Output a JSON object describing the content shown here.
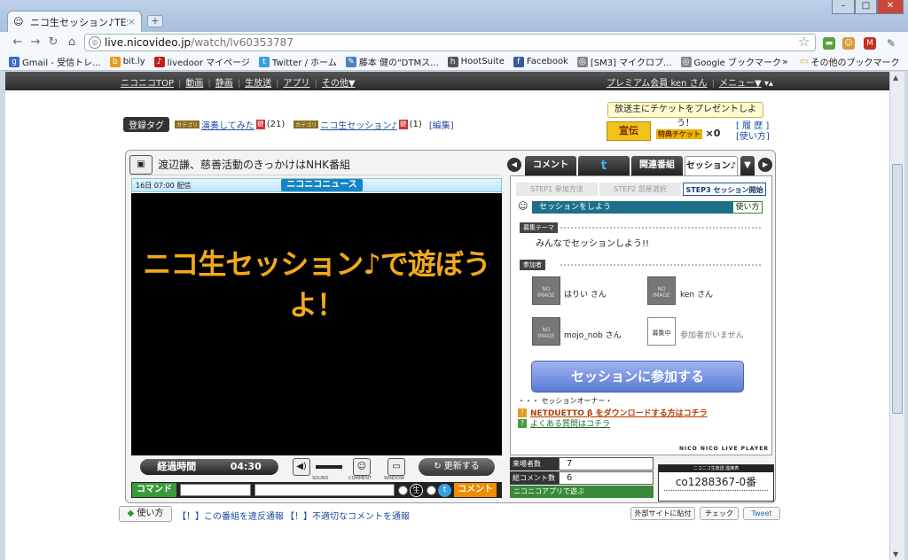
{
  "browser": {
    "tab_title": "ニコ生セッション♪TEST",
    "tab_close": "×",
    "new_tab": "+",
    "url_domain": "live.nicovideo.jp",
    "url_path": "/watch/lv60353787",
    "win_min": "–",
    "win_max": "□",
    "win_close": "✕"
  },
  "bookmarks": [
    "Gmail - 受信トレ...",
    "bit.ly",
    "livedoor マイページ",
    "Twitter / ホーム",
    "藤本 健の\"DTMス...",
    "HootSuite",
    "Facebook",
    "[SM3] マイクロプ...",
    "Google ブックマーク"
  ],
  "bookmarks_more": "»",
  "bookmarks_other": "その他のブックマーク",
  "sitenav": {
    "left": [
      "ニコニコTOP",
      "動画",
      "静画",
      "生放送",
      "アプリ",
      "その他▼"
    ],
    "premium": "プレミアム会員 ken さん",
    "menu": "メニュー▼"
  },
  "tags": {
    "badge": "登録タグ",
    "items": [
      {
        "cat": "カテゴリ",
        "name": "演奏してみた",
        "count": "(21)"
      },
      {
        "cat": "カテゴリ",
        "name": "ニコ生セッション♪",
        "count": "(1)"
      }
    ],
    "edit": "[編集]"
  },
  "ticket": {
    "banner": "放送主にチケットをプレゼントしよう！",
    "senden": "宣伝",
    "tokuten": "特典チケット",
    "count": "×0",
    "history": "[ 履 歴 ]",
    "usage": "[使い方]"
  },
  "player": {
    "title": "渡辺謙、慈善活動のきっかけはNHK番組",
    "news_date": "16日 07:00 配信",
    "news_logo": "ニコニコニュース",
    "message": "ニコ生セッション♪で遊ぼうよ！",
    "elapsed_label": "経過時間",
    "elapsed": "04:30",
    "sound": "SOUND",
    "comment": "COMMENT",
    "window": "WINDOW",
    "refresh": "更新する",
    "command": "コマンド",
    "comment_btn": "コメント"
  },
  "tabs": {
    "comment": "コメント",
    "twitter": "t",
    "related": "関連番組",
    "session": "セッション♪",
    "dropdown": "▼"
  },
  "session": {
    "steps": [
      "STEP1 参加方法",
      "STEP2 部屋選択",
      "STEP3 セッション開始"
    ],
    "bar": "セッションをしよう",
    "howto": "使い方",
    "theme_label": "募集テーマ",
    "theme": "みんなでセッションしよう!!",
    "participants_label": "参加者",
    "participants": [
      {
        "name": "はりい さん",
        "img": "NO IMAGE"
      },
      {
        "name": "ken さん",
        "img": "NO IMAGE"
      },
      {
        "name": "mojo_nob さん",
        "img": "NO IMAGE"
      },
      {
        "name": "参加者がいません",
        "img": "募集中"
      }
    ],
    "join": "セッションに参加する",
    "owner": "・・・ セッションオーナー・",
    "link1": "NETDUETTO β をダウンロードする方はコチラ",
    "link2": "よくある質問はコチラ",
    "brand": "NICO NICO LIVE PLAYER"
  },
  "stats": {
    "visitors_label": "来場者数",
    "visitors": "7",
    "comments_label": "総コメント数",
    "comments": "6",
    "app": "ニコニコアプリで遊ぶ"
  },
  "community": {
    "header": "ニコニコ生放送 座席表",
    "id": "co1288367-0番"
  },
  "footer": {
    "usage": "使い方",
    "report1": "【！】この番組を違反通報",
    "report2": "【！】不適切なコメントを通報",
    "ext": "外部サイトに貼付",
    "check": "チェック",
    "tweet": "Tweet"
  },
  "colors": {
    "accent": "#f2a91c",
    "nico_blue": "#1583c8"
  }
}
